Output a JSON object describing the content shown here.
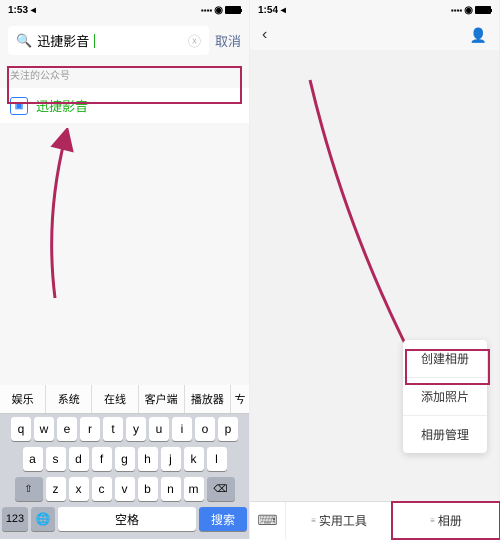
{
  "left": {
    "status": {
      "time": "1:53 ◂"
    },
    "search": {
      "value": "迅捷影音",
      "cancel": "取消"
    },
    "section_label": "关注的公众号",
    "result": {
      "name": "迅捷影音"
    },
    "suggestions": [
      "娱乐",
      "系统",
      "在线",
      "客户端",
      "播放器",
      "ㄘ"
    ],
    "keys": {
      "row1": [
        "q",
        "w",
        "e",
        "r",
        "t",
        "y",
        "u",
        "i",
        "o",
        "p"
      ],
      "row2": [
        "a",
        "s",
        "d",
        "f",
        "g",
        "h",
        "j",
        "k",
        "l"
      ],
      "row3_shift": "⇧",
      "row3": [
        "z",
        "x",
        "c",
        "v",
        "b",
        "n",
        "m"
      ],
      "row3_del": "⌫",
      "num": "123",
      "globe": "🌐",
      "space": "空格",
      "search": "搜索"
    }
  },
  "right": {
    "status": {
      "time": "1:54 ◂"
    },
    "popup": {
      "create": "创建相册",
      "add": "添加照片",
      "manage": "相册管理"
    },
    "bottom": {
      "tools": "实用工具",
      "album": "相册"
    }
  }
}
